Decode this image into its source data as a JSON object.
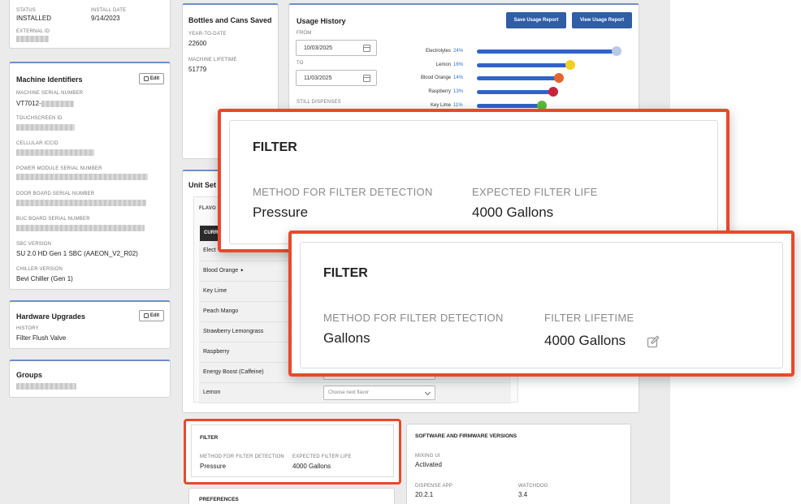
{
  "status_card": {
    "status_label": "STATUS",
    "status_value": "INSTALLED",
    "install_label": "INSTALL DATE",
    "install_value": "9/14/2023",
    "external_label": "EXTERNAL ID"
  },
  "machine_identifiers": {
    "title": "Machine Identifiers",
    "edit_label": "Edit",
    "fields": [
      {
        "label": "MACHINE SERIAL NUMBER",
        "value": "VT7012-"
      },
      {
        "label": "TOUCHSCREEN ID",
        "value": ""
      },
      {
        "label": "CELLULAR ICCID",
        "value": ""
      },
      {
        "label": "POWER MODULE SERIAL NUMBER",
        "value": ""
      },
      {
        "label": "DOOR BOARD SERIAL NUMBER",
        "value": ""
      },
      {
        "label": "BUC BOARD SERIAL NUMBER",
        "value": ""
      },
      {
        "label": "SBC VERSION",
        "value": "SU 2.0 HD Gen 1 SBC (AAEON_V2_R02)"
      },
      {
        "label": "CHILLER VERSION",
        "value": "Bevi Chiller (Gen 1)"
      }
    ]
  },
  "hardware_upgrades": {
    "title": "Hardware Upgrades",
    "edit_label": "Edit",
    "history_label": "HISTORY",
    "history_value": "Filter Flush Valve"
  },
  "groups": {
    "title": "Groups"
  },
  "bottles": {
    "title": "Bottles and Cans Saved",
    "ytd_label": "YEAR-TO-DATE",
    "ytd_value": "22600",
    "lifetime_label": "MACHINE LIFETIME",
    "lifetime_value": "51779"
  },
  "usage": {
    "title": "Usage History",
    "save_button": "Save Usage Report",
    "view_button": "View Usage Report",
    "from_label": "FROM",
    "from_value": "10/03/2025",
    "to_label": "TO",
    "to_value": "11/03/2025",
    "still_label": "STILL DISPENSES",
    "flavors": [
      {
        "name": "Electrolytes",
        "pct": "24%",
        "value": 24,
        "color": "#b9c8e6"
      },
      {
        "name": "Lemon",
        "pct": "16%",
        "value": 16,
        "color": "#f2d21f"
      },
      {
        "name": "Blood Orange",
        "pct": "14%",
        "value": 14,
        "color": "#e8642c"
      },
      {
        "name": "Raspberry",
        "pct": "13%",
        "value": 13,
        "color": "#c9243b"
      },
      {
        "name": "Key Lime",
        "pct": "11%",
        "value": 11,
        "color": "#5fb83a"
      }
    ]
  },
  "unit_settings": {
    "title": "Unit Set",
    "flavor_label": "FLAVO",
    "current_header": "CURR",
    "flavors": [
      {
        "name": "Elect",
        "select": ""
      },
      {
        "name": "Blood Orange",
        "mark": "✦",
        "select": ""
      },
      {
        "name": "Key Lime",
        "select": ""
      },
      {
        "name": "Peach Mango",
        "select": ""
      },
      {
        "name": "Strawberry Lemongrass",
        "select": ""
      },
      {
        "name": "Raspberry",
        "select": ""
      },
      {
        "name": "Energy Boost (Caffeine)",
        "select": ""
      },
      {
        "name": "Lemon",
        "select": "Choose next flavor"
      }
    ]
  },
  "filter_small": {
    "title": "FILTER",
    "method_label": "METHOD FOR FILTER DETECTION",
    "method_value": "Pressure",
    "life_label": "EXPECTED FILTER LIFE",
    "life_value": "4000 Gallons"
  },
  "software": {
    "title": "SOFTWARE AND FIRMWARE VERSIONS",
    "mixing_label": "MIXING UI",
    "mixing_value": "Activated",
    "dispense_label": "DISPENSE APP",
    "dispense_value": "20.2.1",
    "watchdog_label": "WATCHDOG",
    "watchdog_value": "3.4"
  },
  "preferences": {
    "title": "PREFERENCES"
  },
  "callout_before": {
    "title": "FILTER",
    "method_label": "METHOD FOR FILTER DETECTION",
    "method_value": "Pressure",
    "life_label": "EXPECTED FILTER LIFE",
    "life_value": "4000 Gallons"
  },
  "callout_after": {
    "title": "FILTER",
    "method_label": "METHOD FOR FILTER DETECTION",
    "method_value": "Gallons",
    "life_label": "FILTER LIFETIME",
    "life_value": "4000 Gallons"
  }
}
